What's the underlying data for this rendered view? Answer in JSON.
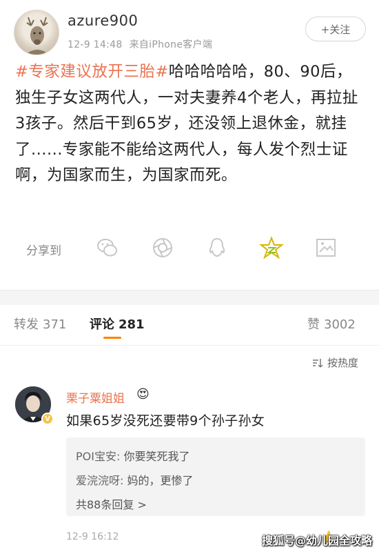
{
  "post": {
    "username": "azure900",
    "date": "12-9 14:48",
    "source": "来自iPhone客户端",
    "follow_label": "+关注",
    "hashtag": "#专家建议放开三胎#",
    "text": "哈哈哈哈哈，80、90后，独生子女这两代人，一对夫妻养4个老人，再拉扯3孩子。然后干到65岁，还没领上退休金，就挂了......专家能不能给这两代人，每人发个烈士证啊，为国家而生，为国家而死。"
  },
  "share": {
    "label": "分享到",
    "icons": [
      "wechat-icon",
      "moments-icon",
      "qq-icon",
      "qzone-icon",
      "picture-icon"
    ]
  },
  "tabs": {
    "repost_label": "转发",
    "repost_count": "371",
    "comment_label": "评论",
    "comment_count": "281",
    "like_label": "赞",
    "like_count": "3002",
    "accent": "#ff8200"
  },
  "sort": {
    "label": "按热度"
  },
  "comment": {
    "name": "栗子粟姐姐",
    "emoji": "😍",
    "text": "如果65岁没死还要带9个孙子孙女",
    "replies": [
      {
        "user": "POI宝安:",
        "text": "你要笑死我了"
      },
      {
        "user": "爱浣浣呀:",
        "text": "妈的，更惨了"
      }
    ],
    "more_replies": "共88条回复 >",
    "time": "12-9 16:12"
  },
  "watermark": "搜狐号@幼儿园全攻略",
  "colors": {
    "link_orange": "#eb7350",
    "text_dark": "#222222"
  }
}
